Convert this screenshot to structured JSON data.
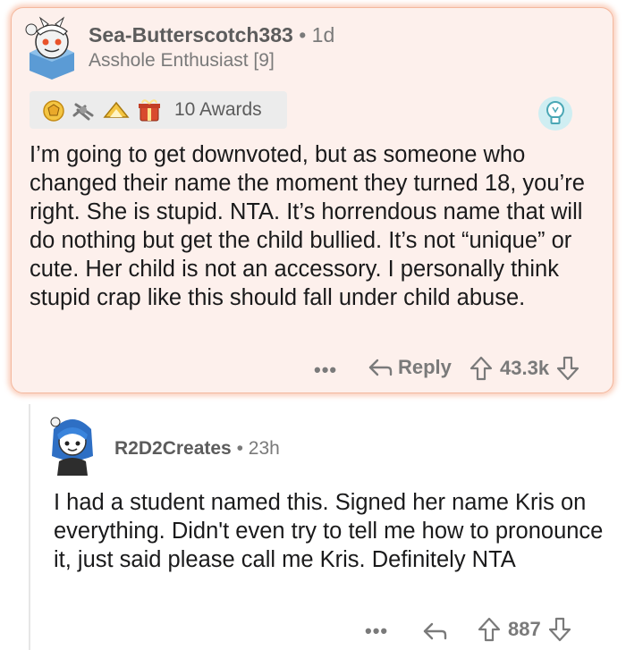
{
  "comment": {
    "author": "Sea-Butterscotch383",
    "time": "1d",
    "flair": "Asshole Enthusiast [9]",
    "awards_label": "10 Awards",
    "body": "I’m going to get downvoted, but as someone who changed their name the moment they turned 18, you’re right. She is stupid. NTA. It’s horrendous name that will do nothing but get the child bullied. It’s not “unique” or cute. Her child is not an accessory. I personally think stupid crap like this should fall under child abuse.",
    "more_label": "•••",
    "reply_label": "Reply",
    "score": "43.3k"
  },
  "reply": {
    "author": "R2D2Creates",
    "time": "23h",
    "body": "I had a student named this. Signed her name Kris on everything. Didn't even try to tell me how to pronounce it, just said please call me Kris. Definitely NTA",
    "more_label": "•••",
    "score": "887"
  },
  "separator": "•",
  "colors": {
    "highlight_bg": "#fdf0ec",
    "highlight_border": "#f4b89e",
    "meta_text": "#7a7a7a",
    "body_text": "#1a1a1b"
  },
  "icons": [
    "snoo-avatar-icon",
    "award-icons",
    "lightbulb-icon",
    "reply-arrow-icon",
    "upvote-arrow-icon",
    "downvote-arrow-icon"
  ]
}
